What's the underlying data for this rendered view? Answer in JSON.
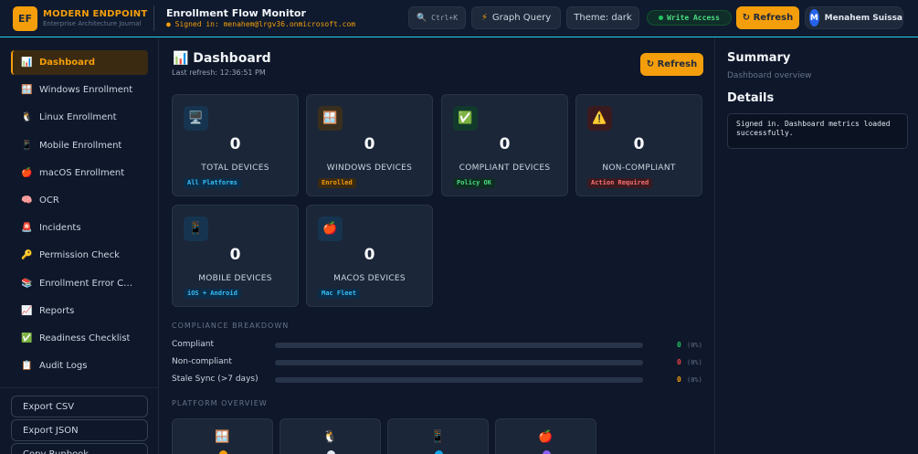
{
  "brand": {
    "logo": "EF",
    "name": "MODERN ENDPOINT",
    "subtitle": "Enterprise Architecture Journal"
  },
  "header": {
    "title": "Enrollment Flow Monitor",
    "signed_in": "● Signed in: menahem@lrgv36.onmicrosoft.com",
    "search_shortcut": "Ctrl+K",
    "graph_query": "Graph Query",
    "theme": "Theme: dark",
    "write_access": "Write Access",
    "refresh": "↻ Refresh",
    "user": {
      "initial": "M",
      "name": "Menahem Suissa"
    }
  },
  "sidebar": {
    "items": [
      {
        "label": "Dashboard",
        "icon": "📊",
        "active": true
      },
      {
        "label": "Windows Enrollment",
        "icon": "🪟"
      },
      {
        "label": "Linux Enrollment",
        "icon": "🐧"
      },
      {
        "label": "Mobile Enrollment",
        "icon": "📱"
      },
      {
        "label": "macOS Enrollment",
        "icon": "🍎"
      },
      {
        "label": "OCR",
        "icon": "🧠"
      },
      {
        "label": "Incidents",
        "icon": "🚨"
      },
      {
        "label": "Permission Check",
        "icon": "🔑"
      },
      {
        "label": "Enrollment Error Catal...",
        "icon": "📚"
      },
      {
        "label": "Reports",
        "icon": "📈"
      },
      {
        "label": "Readiness Checklist",
        "icon": "✅"
      },
      {
        "label": "Audit Logs",
        "icon": "📋"
      }
    ],
    "actions": [
      "Export CSV",
      "Export JSON",
      "Copy Runbook"
    ]
  },
  "main": {
    "title": "📊 Dashboard",
    "last_refresh": "Last refresh: 12:36:51 PM",
    "refresh": "↻ Refresh",
    "cards": [
      {
        "icon": "🖥️",
        "value": "0",
        "label": "TOTAL DEVICES",
        "badge": "All Platforms",
        "badge_color": "#38bdf8",
        "badge_bg": "#0c2d48",
        "icon_bg": "#16344f"
      },
      {
        "icon": "🪟",
        "value": "0",
        "label": "WINDOWS DEVICES",
        "badge": "Enrolled",
        "badge_color": "#f59e0b",
        "badge_bg": "#3a2a12",
        "icon_bg": "#3a2f1e"
      },
      {
        "icon": "✅",
        "value": "0",
        "label": "COMPLIANT DEVICES",
        "badge": "Policy OK",
        "badge_color": "#4ade80",
        "badge_bg": "#0f2e22",
        "icon_bg": "#123a2c"
      },
      {
        "icon": "⚠️",
        "value": "0",
        "label": "NON-COMPLIANT",
        "badge": "Action Required",
        "badge_color": "#f87171",
        "badge_bg": "#3b1a1f",
        "icon_bg": "#3b1a1f"
      },
      {
        "icon": "📱",
        "value": "0",
        "label": "MOBILE DEVICES",
        "badge": "iOS + Android",
        "badge_color": "#38bdf8",
        "badge_bg": "#0c2d48",
        "icon_bg": "#16344f"
      },
      {
        "icon": "🍎",
        "value": "0",
        "label": "MACOS DEVICES",
        "badge": "Mac Fleet",
        "badge_color": "#38bdf8",
        "badge_bg": "#0c2d48",
        "icon_bg": "#16344f"
      }
    ],
    "compliance": {
      "title": "COMPLIANCE BREAKDOWN",
      "rows": [
        {
          "label": "Compliant",
          "count": "0",
          "pct": "(0%)",
          "fraction": 0,
          "color": "#22c55e"
        },
        {
          "label": "Non-compliant",
          "count": "0",
          "pct": "(0%)",
          "fraction": 0,
          "color": "#ef4444"
        },
        {
          "label": "Stale Sync (>7 days)",
          "count": "0",
          "pct": "(0%)",
          "fraction": 0,
          "color": "#f59e0b"
        }
      ]
    },
    "platform": {
      "title": "PLATFORM OVERVIEW",
      "items": [
        {
          "icon": "🪟",
          "color": "#f59e0b"
        },
        {
          "icon": "🐧",
          "color": "#e2e8f0"
        },
        {
          "icon": "📱",
          "color": "#0ea5e9"
        },
        {
          "icon": "🍎",
          "color": "#8b5cf6"
        }
      ]
    }
  },
  "right_panel": {
    "summary_title": "Summary",
    "summary_sub": "Dashboard overview",
    "details_title": "Details",
    "details_text": "Signed in. Dashboard metrics loaded successfully."
  }
}
